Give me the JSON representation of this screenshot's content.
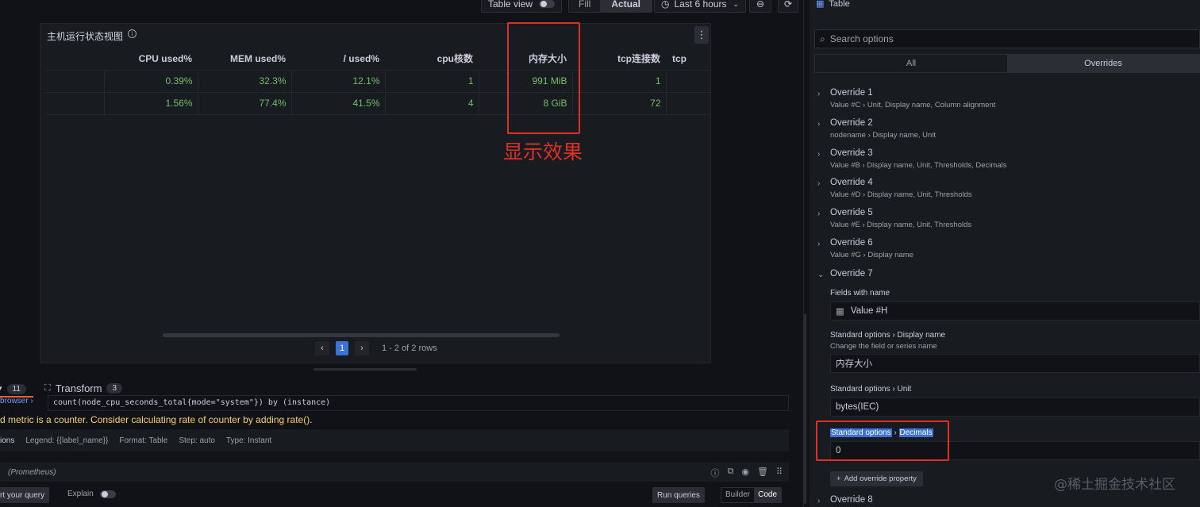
{
  "toolbar": {
    "table_view": "Table view",
    "fill": "Fill",
    "actual": "Actual",
    "time_range": "Last 6 hours"
  },
  "panel": {
    "title": "主机运行状态视图",
    "columns": [
      "",
      "CPU used%",
      "MEM used%",
      "/ used%",
      "cpu核数",
      "内存大小",
      "tcp连接数",
      "tcp"
    ],
    "rows": [
      [
        "",
        "0.39%",
        "32.3%",
        "12.1%",
        "1",
        "991 MiB",
        "1",
        ""
      ],
      [
        "",
        "1.56%",
        "77.4%",
        "41.5%",
        "4",
        "8 GiB",
        "72",
        ""
      ]
    ],
    "page": "1",
    "rows_summary": "1 - 2 of 2 rows"
  },
  "annotation": "显示效果",
  "query": {
    "tab_query_badge": "11",
    "tab_transform": "Transform",
    "tab_transform_badge": "3",
    "metrics_browser": "browser ›",
    "expr": "count(node_cpu_seconds_total{mode=\"system\"}) by (instance)",
    "warning": "d metric is a counter. Consider calculating rate of counter by adding rate().",
    "options_label": "ions",
    "legend": "Legend: {{label_name}}",
    "format": "Format: Table",
    "step": "Step: auto",
    "type": "Type: Instant",
    "datasource": "(Prometheus)",
    "kickstart": "rt your query",
    "explain": "Explain",
    "run": "Run queries",
    "builder": "Builder",
    "code": "Code"
  },
  "options_pane": {
    "viz_name": "Table",
    "search_placeholder": "Search options",
    "tab_all": "All",
    "tab_overrides": "Overrides",
    "overrides": [
      {
        "title": "Override 1",
        "desc": "Value #C  ›  Unit, Display name, Column alignment"
      },
      {
        "title": "Override 2",
        "desc": "nodename  ›  Display name, Unit"
      },
      {
        "title": "Override 3",
        "desc": "Value #B  ›  Display name, Unit, Thresholds, Decimals"
      },
      {
        "title": "Override 4",
        "desc": "Value #D  ›  Display name, Unit, Thresholds"
      },
      {
        "title": "Override 5",
        "desc": "Value #E  ›  Display name, Unit, Thresholds"
      },
      {
        "title": "Override 6",
        "desc": "Value #G  ›  Display name"
      },
      {
        "title": "Override 7",
        "desc": ""
      },
      {
        "title": "Override 8",
        "desc": ""
      }
    ],
    "fields_with_name_label": "Fields with name",
    "fields_with_name_value": "Value #H",
    "display_name_label_a": "Standard options",
    "display_name_label_b": "Display name",
    "display_name_desc": "Change the field or series name",
    "display_name_value": "内存大小",
    "unit_label_a": "Standard options",
    "unit_label_b": "Unit",
    "unit_value": "bytes(IEC)",
    "decimals_label_a": "Standard options",
    "decimals_label_b": "Decimals",
    "decimals_value": "0",
    "add_override_property": "Add override property"
  },
  "watermark": "@稀土掘金技术社区",
  "colors": {
    "background": "#111217",
    "panel": "#181b1f",
    "value_green": "#73bf69",
    "annotation_red": "#e02f24",
    "primary_blue": "#3d71d9",
    "warning_yellow": "#f8d06b"
  }
}
